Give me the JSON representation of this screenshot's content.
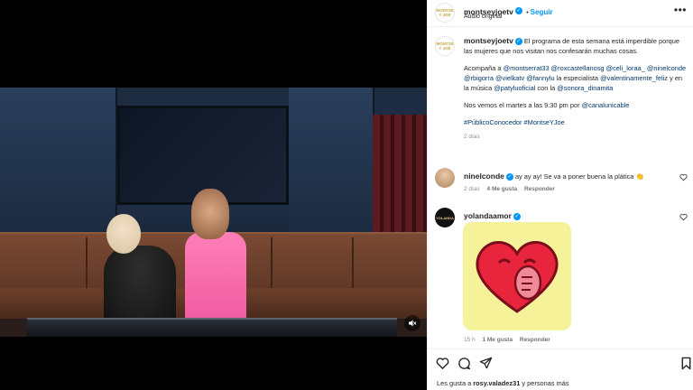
{
  "post": {
    "username": "montseyjoetv",
    "follow_label": "Seguir",
    "audio": "Audio original",
    "avatar_text": "MONTSE Y JOE"
  },
  "caption": {
    "username": "montseyjoetv",
    "line1": "El programa de esta semana está imperdible porque las mujeres que nos visitan nos confesarán muchas cosas.",
    "accompany_intro": "Acompaña a",
    "mentions1": "@montserrat33 @roxcastellanosg @celi_loraa_ @ninelconde @rbigorra @vielkatv @fannylu",
    "specialist_text": "la especialista",
    "mention_specialist": "@valentinamente_feliz",
    "music_text": "y en la música",
    "mention_music": "@patyluoficial",
    "with_text": "con la",
    "mention_sonora": "@sonora_dinamita",
    "see_you": "Nos vemos el martes a las 9:30 pm por",
    "mention_channel": "@canalunicable",
    "hashtags": "#PúblicoConocedor #MontseYJoe",
    "time": "2 días"
  },
  "comments": [
    {
      "username": "ninelconde",
      "text": "ay ay ay! Se va a poner buena la plática",
      "emoji": "👏",
      "time": "2 días",
      "likes": "4 Me gusta",
      "reply": "Responder"
    },
    {
      "username": "yolandaamor",
      "avatar_text": "YOLANDA",
      "time": "15 h",
      "likes": "1 Me gusta",
      "reply": "Responder"
    }
  ],
  "footer": {
    "likes_prefix": "Les gusta a",
    "likes_user": "rosy.valadez31",
    "likes_suffix": "y personas más"
  },
  "colors": {
    "verified": "#0095f6",
    "mention": "#00376b",
    "sticker_bg": "#f6f29a",
    "heart_red": "#e8253c"
  }
}
